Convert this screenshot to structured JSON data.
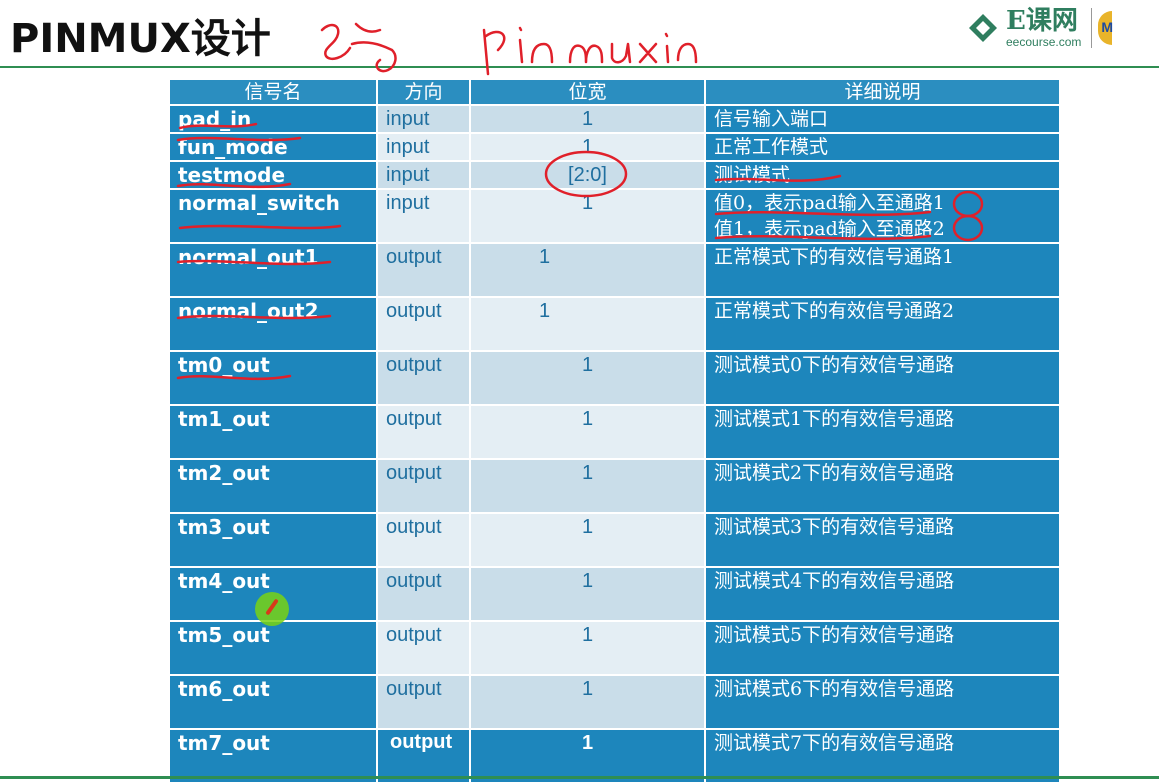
{
  "title": "PINMUX设计",
  "logo": {
    "main": "E课网",
    "sub": "eecourse.com"
  },
  "table": {
    "headers": [
      "信号名",
      "方向",
      "位宽",
      "详细说明"
    ],
    "rows": [
      {
        "name": "pad_in",
        "dir": "input",
        "width": "1",
        "desc": [
          "信号输入端口"
        ]
      },
      {
        "name": "fun_mode",
        "dir": "input",
        "width": "1",
        "desc": [
          "正常工作模式"
        ]
      },
      {
        "name": "testmode",
        "dir": "input",
        "width": "[2:0]",
        "desc": [
          "测试模式"
        ]
      },
      {
        "name": "normal_switch",
        "dir": "input",
        "width": "1",
        "desc": [
          "值0，表示pad输入至通路1",
          "值1，表示pad输入至通路2"
        ]
      },
      {
        "name": "normal_out1",
        "dir": "output",
        "width": "1",
        "desc": [
          "正常模式下的有效信号通路1"
        ]
      },
      {
        "name": "normal_out2",
        "dir": "output",
        "width": "1",
        "desc": [
          "正常模式下的有效信号通路2"
        ]
      },
      {
        "name": "tm0_out",
        "dir": "output",
        "width": "1",
        "desc": [
          "测试模式0下的有效信号通路"
        ]
      },
      {
        "name": "tm1_out",
        "dir": "output",
        "width": "1",
        "desc": [
          "测试模式1下的有效信号通路"
        ]
      },
      {
        "name": "tm2_out",
        "dir": "output",
        "width": "1",
        "desc": [
          "测试模式2下的有效信号通路"
        ]
      },
      {
        "name": "tm3_out",
        "dir": "output",
        "width": "1",
        "desc": [
          "测试模式3下的有效信号通路"
        ]
      },
      {
        "name": "tm4_out",
        "dir": "output",
        "width": "1",
        "desc": [
          "测试模式4下的有效信号通路"
        ]
      },
      {
        "name": "tm5_out",
        "dir": "output",
        "width": "1",
        "desc": [
          "测试模式5下的有效信号通路"
        ]
      },
      {
        "name": "tm6_out",
        "dir": "output",
        "width": "1",
        "desc": [
          "测试模式6下的有效信号通路"
        ]
      },
      {
        "name": "tm7_out",
        "dir": "output",
        "width": "1",
        "desc": [
          "测试模式7下的有效信号通路"
        ]
      }
    ]
  },
  "colors": {
    "header_bg": "#2b8ec0",
    "cell_blue": "#1d86bc",
    "cell_light": "#c9dde9",
    "annotation_red": "#e0202a",
    "rule_green": "#2f8e52"
  },
  "annotations": {
    "handwritten_note": "pin mux in"
  }
}
